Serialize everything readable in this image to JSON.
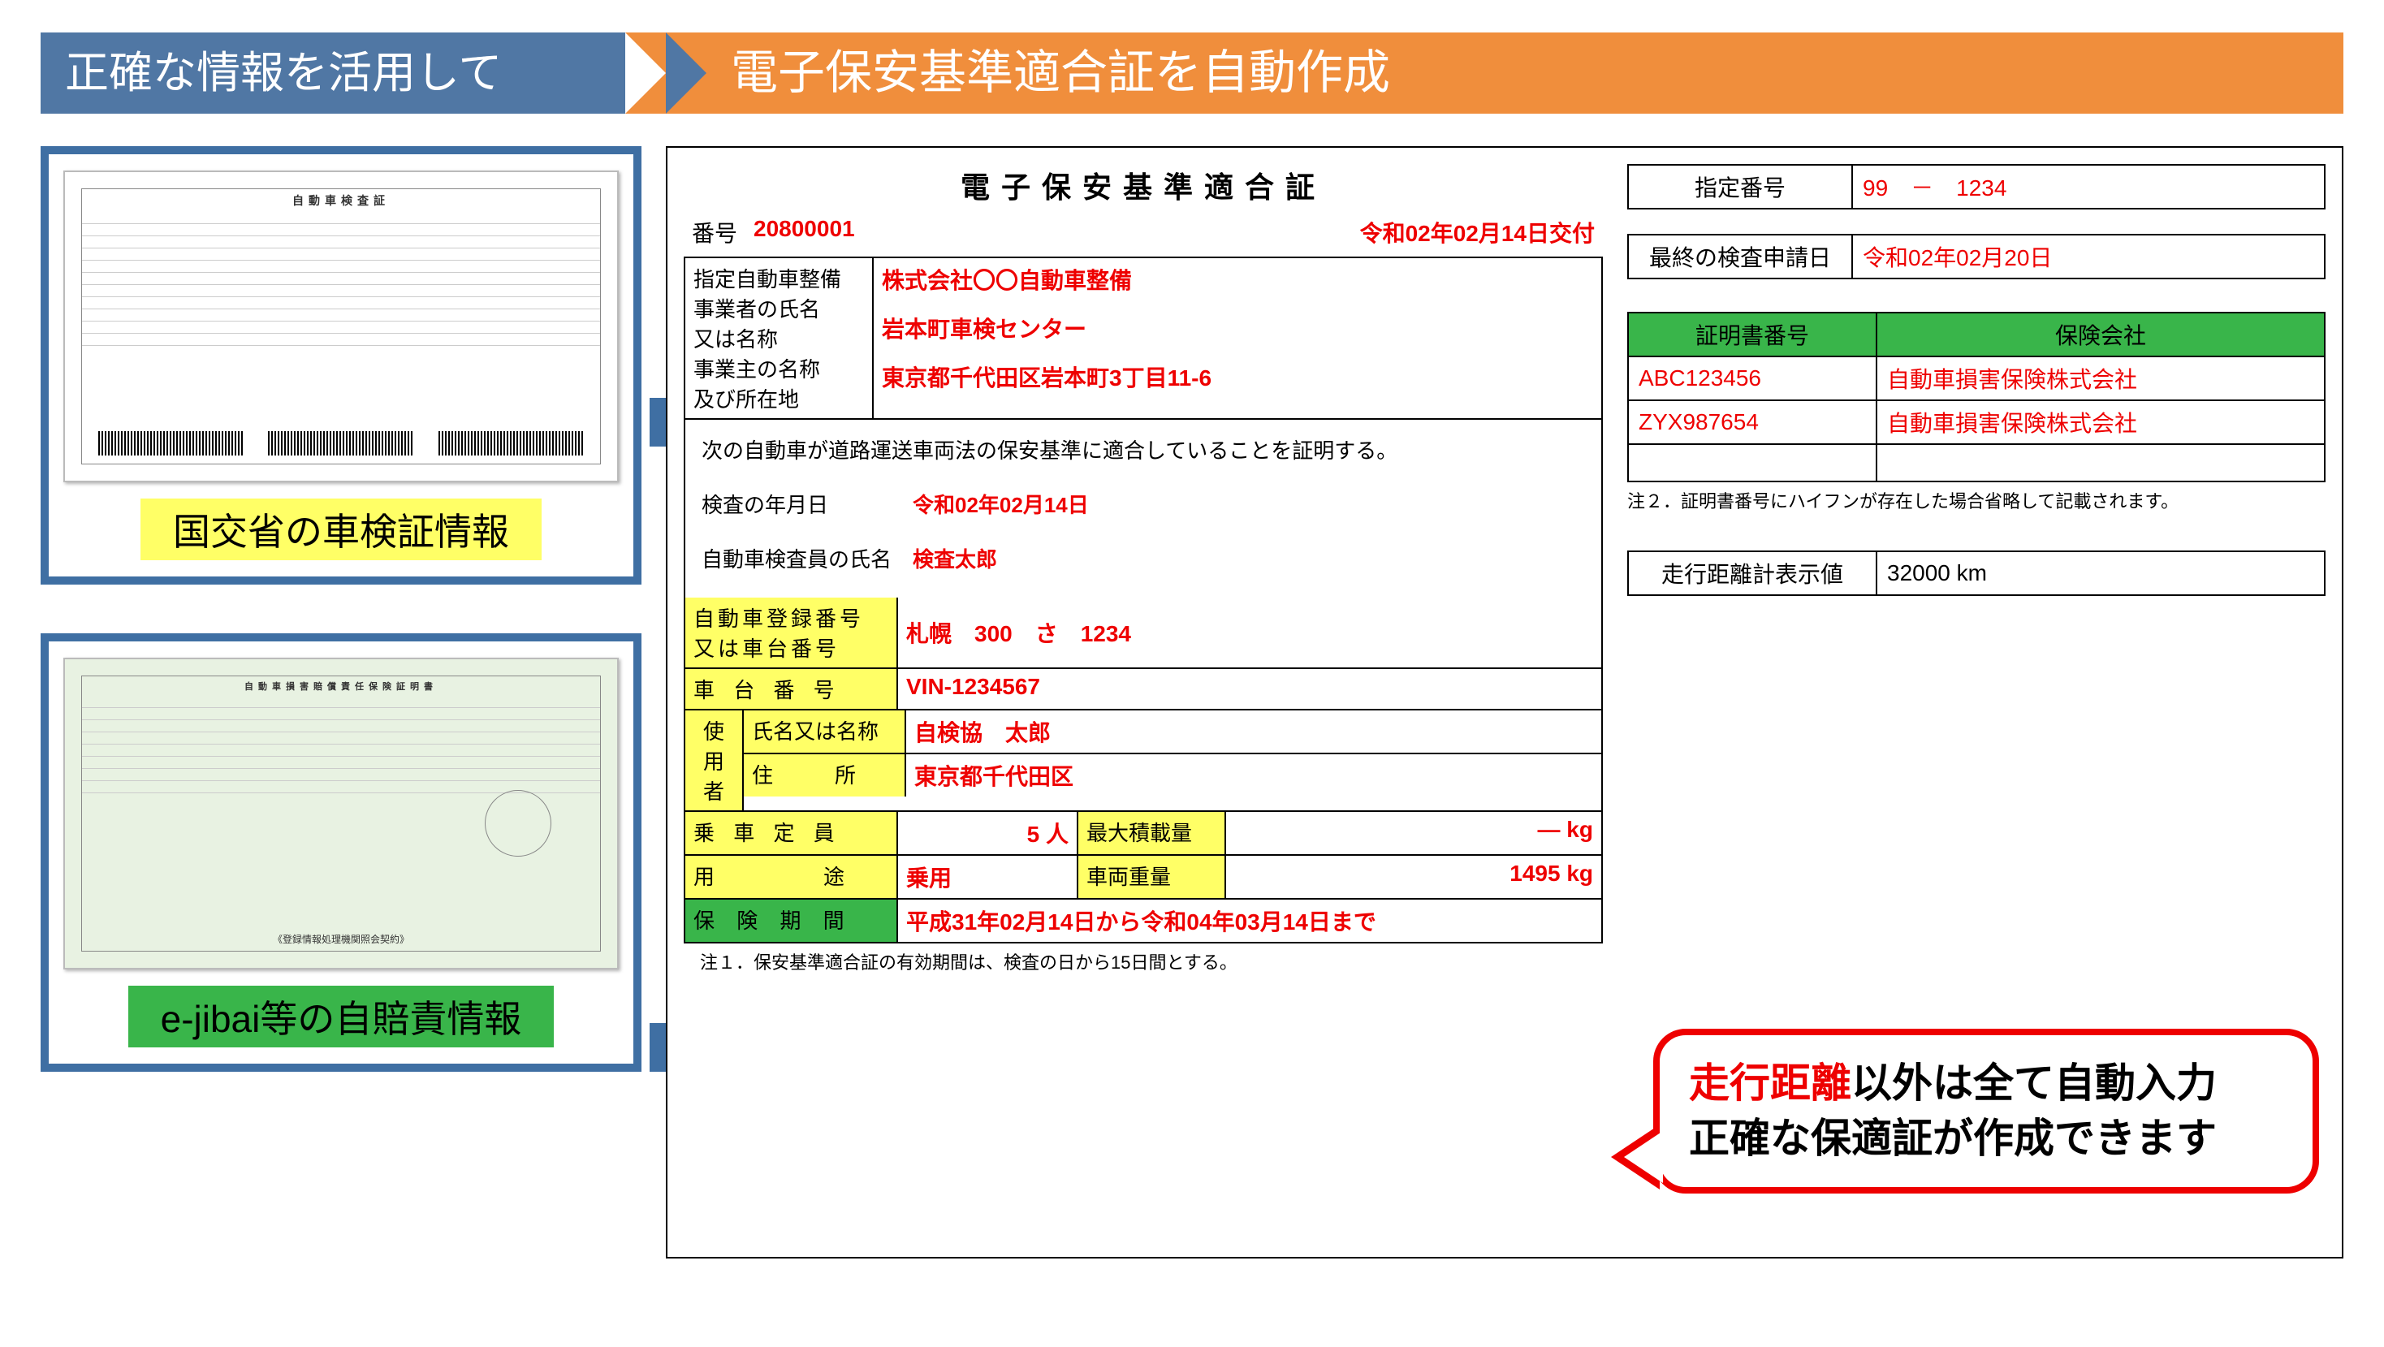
{
  "header": {
    "left": "正確な情報を活用して",
    "right": "電子保安基準適合証を自動作成"
  },
  "left": {
    "card1_caption": "国交省の車検証情報",
    "card1_mini_title": "自動車検査証",
    "card2_caption": "e-jibai等の自賠責情報",
    "card2_mini_title": "自動車損害賠償責任保険証明書",
    "card2_mini_foot": "《登録情報処理機関照会契約》"
  },
  "cert": {
    "title": "電子保安基準適合証",
    "no_label": "番号",
    "no_value": "20800001",
    "issue": "令和02年02月14日交付",
    "biz_label": "指定自動車整備\n事業者の氏名\n又は名称\n事業主の名称\n及び所在地",
    "biz_name1": "株式会社〇〇自動車整備",
    "biz_name2": "岩本町車検センター",
    "biz_addr": "東京都千代田区岩本町3丁目11-6",
    "stmt": "次の自動車が道路運送車両法の保安基準に適合していることを証明する。",
    "insp_date_l": "検査の年月日",
    "insp_date_v": "令和02年02月14日",
    "inspector_l": "自動車検査員の氏名",
    "inspector_v": "検査太郎",
    "reg_l": "自動車登録番号\n又は車台番号",
    "reg_v": "札幌　300　さ　1234",
    "vin_l": "車 台 番 号",
    "vin_v": "VIN-1234567",
    "user_l": "使\n用\n者",
    "user_name_l": "氏名又は名称",
    "user_name_v": "自検協　太郎",
    "user_addr_l": "住　　所",
    "user_addr_v": "東京都千代田区",
    "cap_l": "乗 車 定 員",
    "cap_v": "5 人",
    "maxload_l": "最大積載量",
    "maxload_v": "— kg",
    "use_l": "用　　　途",
    "use_v": "乗用",
    "weight_l": "車両重量",
    "weight_v": "1495 kg",
    "ins_l": "保 険 期 間",
    "ins_v": "平成31年02月14日から令和04年03月14日まで",
    "note1": "注１．保安基準適合証の有効期間は、検査の日から15日間とする。"
  },
  "right": {
    "desig_l": "指定番号",
    "desig_v": "99　－　1234",
    "last_l": "最終の検査申請日",
    "last_v": "令和02年02月20日",
    "ins_th1": "証明書番号",
    "ins_th2": "保険会社",
    "ins_rows": [
      {
        "no": "ABC123456",
        "co": "自動車損害保険株式会社"
      },
      {
        "no": "ZYX987654",
        "co": "自動車損害保険株式会社"
      }
    ],
    "note2": "注２．証明書番号にハイフンが存在した場合省略して記載されます。",
    "odo_l": "走行距離計表示値",
    "odo_v": "32000 km"
  },
  "bubble": {
    "l1a": "走行距離",
    "l1b": "以外は全て自動入力",
    "l2": "正確な保適証が作成できます"
  }
}
